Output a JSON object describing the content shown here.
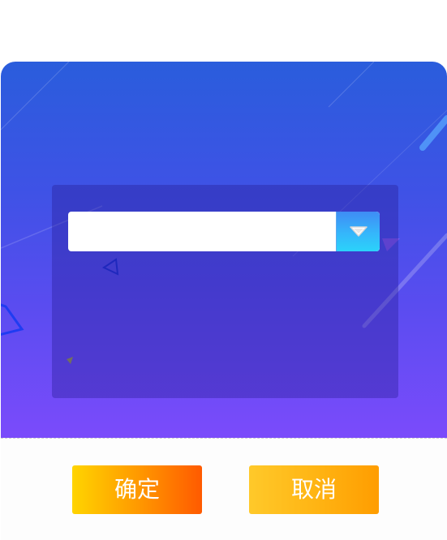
{
  "dialog": {
    "select": {
      "value": "",
      "toggle_icon": "triangle-down-icon"
    },
    "buttons": {
      "confirm_label": "确定",
      "cancel_label": "取消"
    }
  },
  "colors": {
    "gradient_top": "#2a5ddc",
    "gradient_bottom": "#7b4bfb",
    "confirm_start": "#ffd400",
    "confirm_end": "#ff5a00",
    "cancel_start": "#ffc92a",
    "cancel_end": "#ff9d00",
    "toggle_top": "#3f8cf5",
    "toggle_bottom": "#2bd3fa"
  }
}
